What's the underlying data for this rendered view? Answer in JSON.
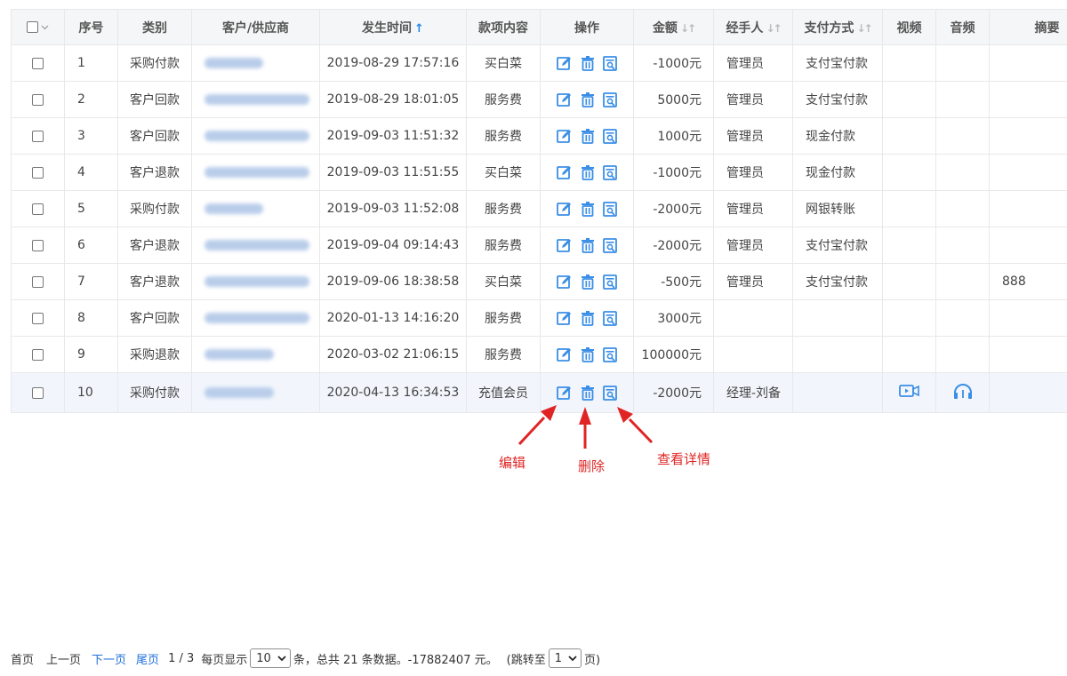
{
  "headers": {
    "seq": "序号",
    "category": "类别",
    "party": "客户/供应商",
    "time": "发生时间",
    "content": "款项内容",
    "ops": "操作",
    "amount": "金额",
    "handler": "经手人",
    "pay": "支付方式",
    "video": "视频",
    "audio": "音频",
    "summary": "摘要"
  },
  "sort_time_icon": "↑",
  "sort_gray_icon": "↓↑",
  "rows": [
    {
      "seq": "1",
      "category": "采购付款",
      "time": "2019-08-29 17:57:16",
      "content": "买白菜",
      "amount": "-1000元",
      "handler": "管理员",
      "pay": "支付宝付款",
      "video": "",
      "audio": "",
      "summary": ""
    },
    {
      "seq": "2",
      "category": "客户回款",
      "time": "2019-08-29 18:01:05",
      "content": "服务费",
      "amount": "5000元",
      "handler": "管理员",
      "pay": "支付宝付款",
      "video": "",
      "audio": "",
      "summary": ""
    },
    {
      "seq": "3",
      "category": "客户回款",
      "time": "2019-09-03 11:51:32",
      "content": "服务费",
      "amount": "1000元",
      "handler": "管理员",
      "pay": "现金付款",
      "video": "",
      "audio": "",
      "summary": ""
    },
    {
      "seq": "4",
      "category": "客户退款",
      "time": "2019-09-03 11:51:55",
      "content": "买白菜",
      "amount": "-1000元",
      "handler": "管理员",
      "pay": "现金付款",
      "video": "",
      "audio": "",
      "summary": ""
    },
    {
      "seq": "5",
      "category": "采购付款",
      "time": "2019-09-03 11:52:08",
      "content": "服务费",
      "amount": "-2000元",
      "handler": "管理员",
      "pay": "网银转账",
      "video": "",
      "audio": "",
      "summary": ""
    },
    {
      "seq": "6",
      "category": "客户退款",
      "time": "2019-09-04 09:14:43",
      "content": "服务费",
      "amount": "-2000元",
      "handler": "管理员",
      "pay": "支付宝付款",
      "video": "",
      "audio": "",
      "summary": ""
    },
    {
      "seq": "7",
      "category": "客户退款",
      "time": "2019-09-06 18:38:58",
      "content": "买白菜",
      "amount": "-500元",
      "handler": "管理员",
      "pay": "支付宝付款",
      "video": "",
      "audio": "",
      "summary": "888"
    },
    {
      "seq": "8",
      "category": "客户回款",
      "time": "2020-01-13 14:16:20",
      "content": "服务费",
      "amount": "3000元",
      "handler": "",
      "pay": "",
      "video": "",
      "audio": "",
      "summary": ""
    },
    {
      "seq": "9",
      "category": "采购退款",
      "time": "2020-03-02 21:06:15",
      "content": "服务费",
      "amount": "100000元",
      "handler": "",
      "pay": "",
      "video": "",
      "audio": "",
      "summary": ""
    },
    {
      "seq": "10",
      "category": "采购付款",
      "time": "2020-04-13 16:34:53",
      "content": "充值会员",
      "amount": "-2000元",
      "handler": "经理-刘备",
      "pay": "",
      "video": "video-icon",
      "audio": "headphones-icon",
      "summary": ""
    }
  ],
  "icons": {
    "edit": "edit-icon",
    "delete": "trash-icon",
    "view": "view-detail-icon"
  },
  "annotations": {
    "edit": "编辑",
    "delete": "删除",
    "view": "查看详情"
  },
  "pager": {
    "first": "首页",
    "prev": "上一页",
    "next": "下一页",
    "last": "尾页",
    "page_info": "1 / 3",
    "per_page_label": "每页显示",
    "per_page": "10",
    "summary": "条，总共 21 条数据。-17882407 元。",
    "jump_prefix": "(跳转至",
    "jump_page": "1",
    "jump_suffix": "页)"
  },
  "colors": {
    "accent": "#1e88e5",
    "annotation": "#e02424",
    "link": "#1e6fd9",
    "header_bg": "#f5f6f7"
  }
}
